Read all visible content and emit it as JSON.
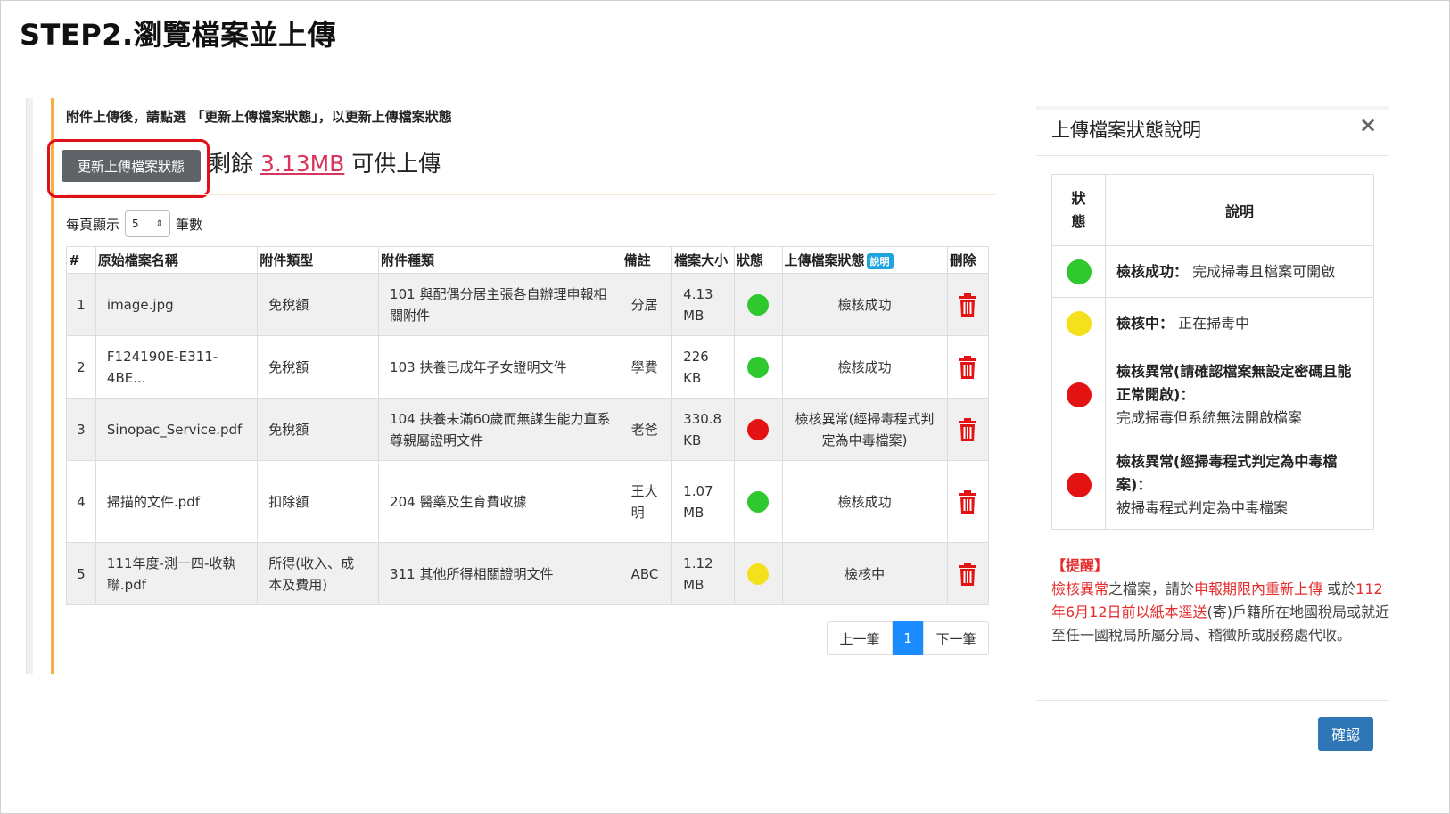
{
  "page": {
    "title": "STEP2.瀏覽檔案並上傳"
  },
  "upload": {
    "instruction": "附件上傳後，請點選 「更新上傳檔案狀態」，以更新上傳檔案狀態",
    "refresh_button": "更新上傳檔案狀態",
    "quota_prefix": "剩餘 ",
    "quota_amount": "3.13MB",
    "quota_suffix": " 可供上傳",
    "perpage_label": "每頁顯示",
    "perpage_value": "5",
    "perpage_unit": "筆數"
  },
  "table": {
    "headers": {
      "num": "#",
      "filename": "原始檔案名稱",
      "type": "附件類型",
      "category": "附件種類",
      "note": "備註",
      "size": "檔案大小",
      "status": "狀態",
      "upload_status": "上傳檔案狀態",
      "help_badge": "說明",
      "delete": "刪除"
    },
    "rows": [
      {
        "num": "1",
        "filename": "image.jpg",
        "type": "免稅額",
        "category": "101 與配偶分居主張各自辦理申報相關附件",
        "note": "分居",
        "size": "4.13 MB",
        "status": "green",
        "upload_status": "檢核成功"
      },
      {
        "num": "2",
        "filename": "F124190E-E311-4BE...",
        "type": "免稅額",
        "category": "103 扶養已成年子女證明文件",
        "note": "學費",
        "size": "226 KB",
        "status": "green",
        "upload_status": "檢核成功"
      },
      {
        "num": "3",
        "filename": "Sinopac_Service.pdf",
        "type": "免稅額",
        "category": "104 扶養未滿60歲而無謀生能力直系尊親屬證明文件",
        "note": "老爸",
        "size": "330.8 KB",
        "status": "red",
        "upload_status": "檢核異常(經掃毒程式判定為中毒檔案)"
      },
      {
        "num": "4",
        "filename": "掃描的文件.pdf",
        "type": "扣除額",
        "category": "204 醫藥及生育費收據",
        "note": "王大明",
        "size": "1.07 MB",
        "status": "green",
        "upload_status": "檢核成功"
      },
      {
        "num": "5",
        "filename": "111年度-測一四-收執聯.pdf",
        "type": "所得(收入、成本及費用)",
        "category": "311 其他所得相關證明文件",
        "note": "ABC",
        "size": "1.12 MB",
        "status": "yellow",
        "upload_status": "檢核中"
      }
    ]
  },
  "pagination": {
    "prev": "上一筆",
    "current": "1",
    "next": "下一筆"
  },
  "modal": {
    "title": "上傳檔案狀態說明",
    "close": "×",
    "col_status": "狀態",
    "col_desc": "說明",
    "legend": [
      {
        "color": "green",
        "strong": "檢核成功：",
        "text": " 完成掃毒且檔案可開啟"
      },
      {
        "color": "yellow",
        "strong": "檢核中：",
        "text": " 正在掃毒中"
      },
      {
        "color": "red",
        "strong": "檢核異常(請確認檔案無設定密碼且能正常開啟)：",
        "text": "完成掃毒但系統無法開啟檔案"
      },
      {
        "color": "red",
        "strong": "檢核異常(經掃毒程式判定為中毒檔案)：",
        "text": "被掃毒程式判定為中毒檔案"
      }
    ],
    "reminder": {
      "title": "【提醒】",
      "p1_red": "檢核異常",
      "p1": "之檔案，請於",
      "p2_red": "申報期限內重新上傳",
      "p3": " 或於",
      "p4_red": "112年6月12日前以紙本逕送",
      "p5": "(寄)戶籍所在地國稅局或就近至任一國稅局所屬分局、稽徵所或服務處代收。"
    },
    "confirm": "確認"
  },
  "colors": {
    "green": "#2fc82f",
    "red": "#e41313",
    "yellow": "#f4e01b",
    "accent": "#1a8cff",
    "highlight": "#e0101a"
  }
}
